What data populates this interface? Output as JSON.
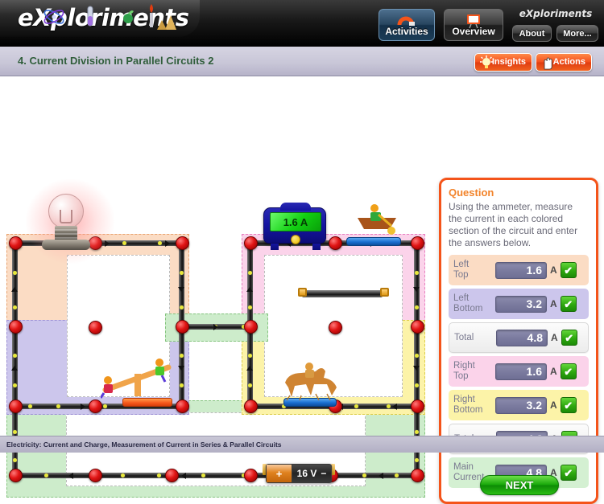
{
  "app": {
    "logo_text": "eXploriments",
    "brandmark": "eXploriments"
  },
  "nav": {
    "activities": {
      "label": "Activities",
      "icon": "magnet-icon"
    },
    "overview": {
      "label": "Overview",
      "icon": "presentation-board-icon"
    },
    "about": {
      "label": "About"
    },
    "more": {
      "label": "More..."
    }
  },
  "title": {
    "page": "4. Current Division in Parallel Circuits 2",
    "insights": "Insights",
    "actions": "Actions"
  },
  "circuit": {
    "ammeter_reading": "1.6 A",
    "battery_voltage": "16 V",
    "battery_positive": "+",
    "battery_negative": "−",
    "components": {
      "bulb": "light-bulb",
      "seesaw": "seesaw-figure",
      "carousel_horse": "carousel-horse-figure",
      "rowing_boat": "rowing-boat-figure",
      "connector": "wire-connector"
    },
    "zone_colors": {
      "left_top": "#fbdcc4",
      "left_bottom": "#ccc6ec",
      "right_top": "#fbd3ea",
      "right_bottom": "#fcf3a8",
      "main": "#cdeccb"
    }
  },
  "question": {
    "heading": "Question",
    "text": "Using the ammeter, measure the current in each colored section of the circuit and enter the answers below.",
    "unit": "A",
    "check_mark": "✔",
    "rows": [
      {
        "label": "Left Top",
        "label_line1": "Left",
        "label_line2": "Top",
        "value": "1.6",
        "correct": true
      },
      {
        "label": "Left Bottom",
        "label_line1": "Left",
        "label_line2": "Bottom",
        "value": "3.2",
        "correct": true
      },
      {
        "label": "Total",
        "label_line1": "Total",
        "label_line2": "",
        "value": "4.8",
        "correct": true
      },
      {
        "label": "Right Top",
        "label_line1": "Right",
        "label_line2": "Top",
        "value": "1.6",
        "correct": true
      },
      {
        "label": "Right Bottom",
        "label_line1": "Right",
        "label_line2": "Bottom",
        "value": "3.2",
        "correct": true
      },
      {
        "label": "Total",
        "label_line1": "Total",
        "label_line2": "",
        "value": "4.8",
        "correct": true
      },
      {
        "label": "Main Current",
        "label_line1": "Main",
        "label_line2": "Current",
        "value": "4.8",
        "correct": true
      }
    ],
    "next": "NEXT"
  },
  "footer": {
    "text": "Electricity: Current and Charge, Measurement of Current in Series & Parallel Circuits"
  }
}
